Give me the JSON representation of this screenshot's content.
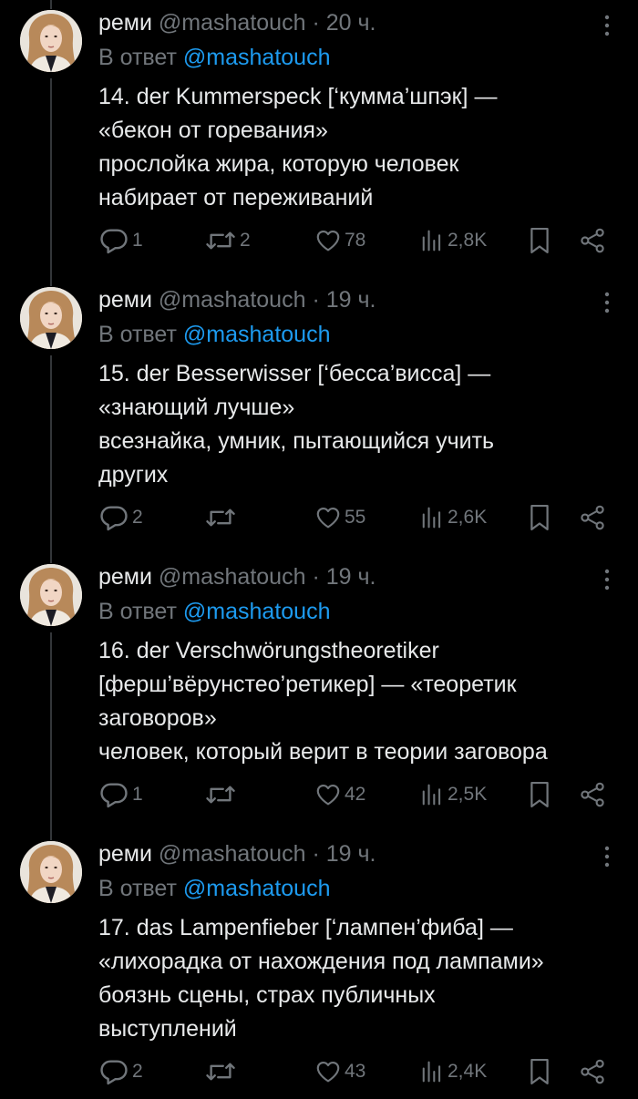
{
  "tweets": [
    {
      "name": "реми",
      "handle": "@mashatouch",
      "dot": "·",
      "time": "20 ч.",
      "reply_prefix": "В ответ",
      "reply_to": "@mashatouch",
      "lines": [
        "14. der Kummerspeck [‘кумма’шпэк] —",
        "«бекон от горевания»",
        "прослойка жира, которую человек",
        "набирает от переживаний"
      ],
      "replies": "1",
      "reposts": "2",
      "likes": "78",
      "views": "2,8K"
    },
    {
      "name": "реми",
      "handle": "@mashatouch",
      "dot": "·",
      "time": "19 ч.",
      "reply_prefix": "В ответ",
      "reply_to": "@mashatouch",
      "lines": [
        "15. der Besserwisser [‘бесса’висса] —",
        "«знающий лучше»",
        "всезнайка, умник, пытающийся учить",
        "других"
      ],
      "replies": "2",
      "reposts": "",
      "likes": "55",
      "views": "2,6K"
    },
    {
      "name": "реми",
      "handle": "@mashatouch",
      "dot": "·",
      "time": "19 ч.",
      "reply_prefix": "В ответ",
      "reply_to": "@mashatouch",
      "lines": [
        "16. der Verschwörungstheoretiker",
        "[ферш’вёрунстео’ретикер] — «теоретик",
        "заговоров»",
        "человек, который верит в теории заговора"
      ],
      "replies": "1",
      "reposts": "",
      "likes": "42",
      "views": "2,5K"
    },
    {
      "name": "реми",
      "handle": "@mashatouch",
      "dot": "·",
      "time": "19 ч.",
      "reply_prefix": "В ответ",
      "reply_to": "@mashatouch",
      "lines": [
        "17. das Lampenfieber [‘лампен’фиба] —",
        "«лихорадка от нахождения под лампами»",
        "боязнь сцены, страх публичных",
        "выступлений"
      ],
      "replies": "2",
      "reposts": "",
      "likes": "43",
      "views": "2,4K"
    }
  ],
  "colors": {
    "background": "#000000",
    "text": "#e7e9ea",
    "muted": "#71767b",
    "link": "#1d9bf0",
    "thread_line": "#333639"
  },
  "icons": {
    "more": "more-vertical-icon",
    "reply": "reply-bubble-icon",
    "repost": "repost-arrows-icon",
    "like": "heart-icon",
    "views": "views-bars-icon",
    "bookmark": "bookmark-icon",
    "share": "share-nodes-icon"
  }
}
